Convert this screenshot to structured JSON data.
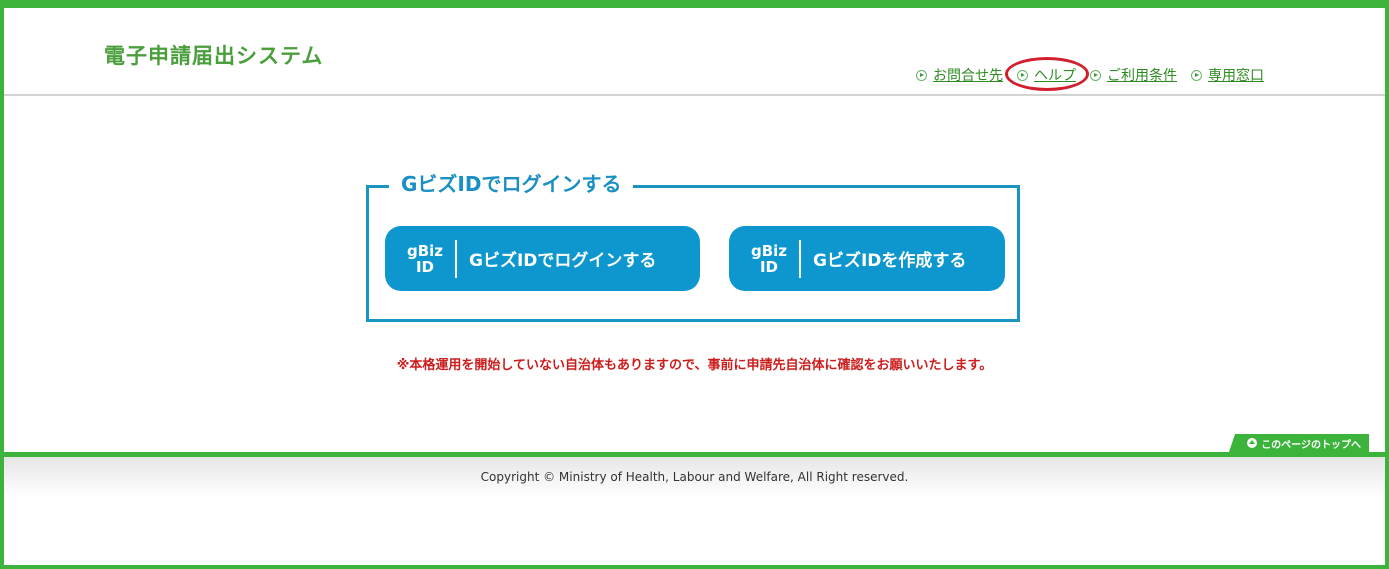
{
  "header": {
    "site_title": "電子申請届出システム",
    "nav": [
      {
        "label": "お問合せ先"
      },
      {
        "label": "ヘルプ"
      },
      {
        "label": "ご利用条件"
      },
      {
        "label": "専用窓口"
      }
    ]
  },
  "login": {
    "legend": "GビズIDでログインする",
    "logo_top": "gBiz",
    "logo_bottom": "ID",
    "login_button_label": "GビズIDでログインする",
    "create_button_label": "GビズIDを作成する"
  },
  "notice": "※本格運用を開始していない自治体もありますので、事前に申請先自治体に確認をお願いいたします。",
  "page_top_label": "このページのトップへ",
  "footer": {
    "copyright": "Copyright © Ministry of Health, Labour and Welfare, All Right reserved."
  },
  "colors": {
    "frame_green": "#3cb43c",
    "title_green": "#4a9e3b",
    "button_blue": "#0e97cf",
    "box_border": "#1a95bf",
    "notice_red": "#cc1d1d",
    "annotation_red": "#d21f2e"
  },
  "icons": [
    "play-circle-icon",
    "gbizid-logo-icon",
    "arrow-up-icon"
  ]
}
